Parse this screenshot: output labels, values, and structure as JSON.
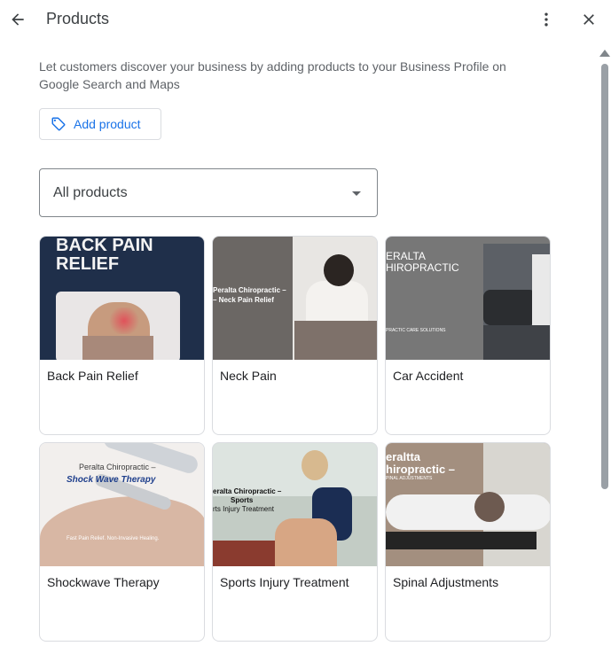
{
  "header": {
    "title": "Products",
    "back_icon": "arrow-back-icon",
    "more_icon": "more-vert-icon",
    "close_icon": "close-icon"
  },
  "description": "Let customers discover your business by adding products to your Business Profile on Google Search and Maps",
  "add_product": {
    "label": "Add product",
    "icon": "tag-icon"
  },
  "filter": {
    "selected": "All products"
  },
  "products": [
    {
      "label": "Back Pain Relief",
      "img_text": "BACK PAIN RELIEF"
    },
    {
      "label": "Neck Pain",
      "img_text_1": "Peralta Chiropractic –",
      "img_text_2": "– Neck Pain Relief"
    },
    {
      "label": "Car Accident",
      "img_text_1": "ERALTA",
      "img_text_2": "HIROPRACTIC",
      "img_text_3": "PRACTIC CARE SOLUTIONS"
    },
    {
      "label": "Shockwave Therapy",
      "img_text_1": "Peralta Chiropractic –",
      "img_text_2": "Shock Wave Therapy",
      "img_text_3": "Fast Pain Relief. Non-Invasive Healing."
    },
    {
      "label": "Sports Injury Treatment",
      "img_text_1": "eralta Chiropractic –",
      "img_text_2": "Sports",
      "img_text_3": "rts Injury Treatment"
    },
    {
      "label": "Spinal Adjustments",
      "img_text_1": "eraltta",
      "img_text_2": "hiropractic –",
      "img_text_3": "PINAL ADJUSTMENTS"
    }
  ],
  "colors": {
    "accent": "#1a73e8",
    "border": "#dadce0"
  }
}
